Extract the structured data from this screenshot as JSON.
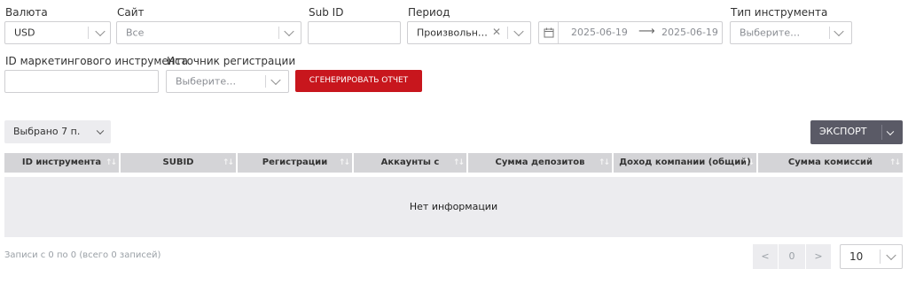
{
  "filters": {
    "currency": {
      "label": "Валюта",
      "value": "USD"
    },
    "site": {
      "label": "Сайт",
      "value": "Все"
    },
    "subid": {
      "label": "Sub ID",
      "value": ""
    },
    "period": {
      "label": "Период",
      "value": "Произвольн…",
      "date_from": "2025-06-19",
      "date_to": "2025-06-19",
      "arrow": "⟶"
    },
    "instrument_type": {
      "label": "Тип инструмента",
      "placeholder": "Выберите…"
    },
    "marketing_id": {
      "label": "ID маркетингового инструмента",
      "value": ""
    },
    "reg_source": {
      "label": "Источник регистрации",
      "placeholder": "Выберите…"
    },
    "generate_button": "СГЕНЕРИРОВАТЬ ОТЧЕТ"
  },
  "columns_select": "Выбрано 7 п.",
  "export_button": "ЭКСПОРТ",
  "table": {
    "headers": [
      "ID инструмента",
      "SUBID",
      "Регистрации",
      "Аккаунты с депозитами",
      "Сумма депозитов",
      "Доход компании (общий)",
      "Сумма комиссий"
    ],
    "empty_text": "Нет информации"
  },
  "footer": {
    "records_text": "Записи с 0 по 0 (всего 0 записей)",
    "prev": "<",
    "page": "0",
    "next": ">",
    "page_size": "10"
  },
  "colors": {
    "accent": "#c8161d",
    "export_bg": "#5a5a66",
    "header_bg": "#d4d4d7",
    "empty_bg": "#ececef"
  }
}
